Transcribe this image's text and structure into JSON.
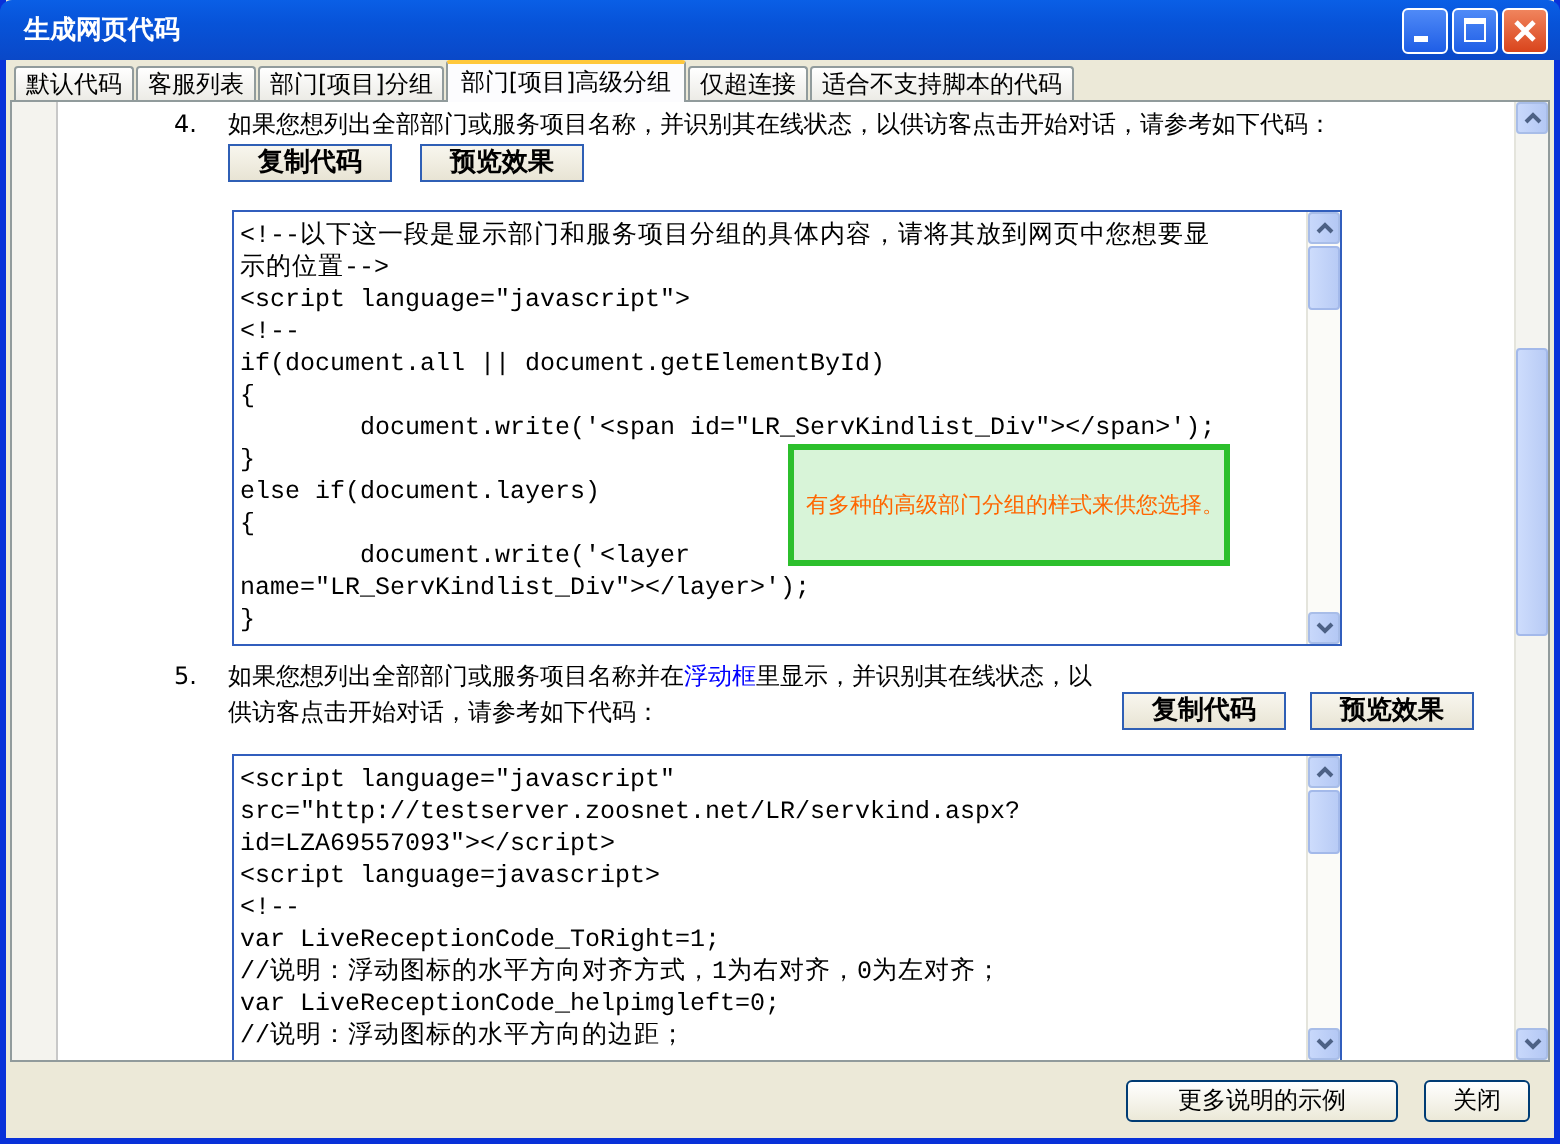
{
  "window": {
    "title": "生成网页代码"
  },
  "tabs": [
    {
      "label": "默认代码",
      "selected": false
    },
    {
      "label": "客服列表",
      "selected": false
    },
    {
      "label": "部门[项目]分组",
      "selected": false
    },
    {
      "label": "部门[项目]高级分组",
      "selected": true
    },
    {
      "label": "仅超连接",
      "selected": false
    },
    {
      "label": "适合不支持脚本的代码",
      "selected": false
    }
  ],
  "sections": [
    {
      "number": "4.",
      "text": "如果您想列出全部部门或服务项目名称，并识别其在线状态，以供访客点击开始对话，请参考如下代码：",
      "buttons": [
        "复制代码",
        "预览效果"
      ],
      "code_lines": [
        "<!--以下这一段是显示部门和服务项目分组的具体内容，请将其放到网页中您想要显",
        "示的位置-->",
        "<script language=\"javascript\">",
        "<!--",
        "if(document.all || document.getElementById)",
        "{",
        "        document.write('<span id=\"LR_ServKindlist_Div\"></span>');",
        "}",
        "else if(document.layers)",
        "{",
        "        document.write('<layer",
        "name=\"LR_ServKindlist_Div\"></layer>');",
        "}"
      ],
      "callout": {
        "text": "有多种的高级部门分组的样式来供您选择。"
      }
    },
    {
      "number": "5.",
      "link": "浮动框",
      "text_before": "如果您想列出全部部门或服务项目名称并在",
      "text_after": "里显示，并识别其在线状态，以供访客点击开始对话，请参考如下代码：",
      "buttons": [
        "复制代码",
        "预览效果"
      ],
      "code_lines": [
        "<script language=\"javascript\"",
        "src=\"http://testserver.zoosnet.net/LR/servkind.aspx?",
        "id=LZA69557093\"></script>",
        "<script language=javascript>",
        "<!--",
        "var LiveReceptionCode_ToRight=1;",
        "//说明：浮动图标的水平方向对齐方式，1为右对齐，0为左对齐；",
        "var LiveReceptionCode_helpimgleft=0;",
        "//说明：浮动图标的水平方向的边距；"
      ]
    }
  ],
  "footer_buttons": [
    "更多说明的示例",
    "关闭"
  ]
}
